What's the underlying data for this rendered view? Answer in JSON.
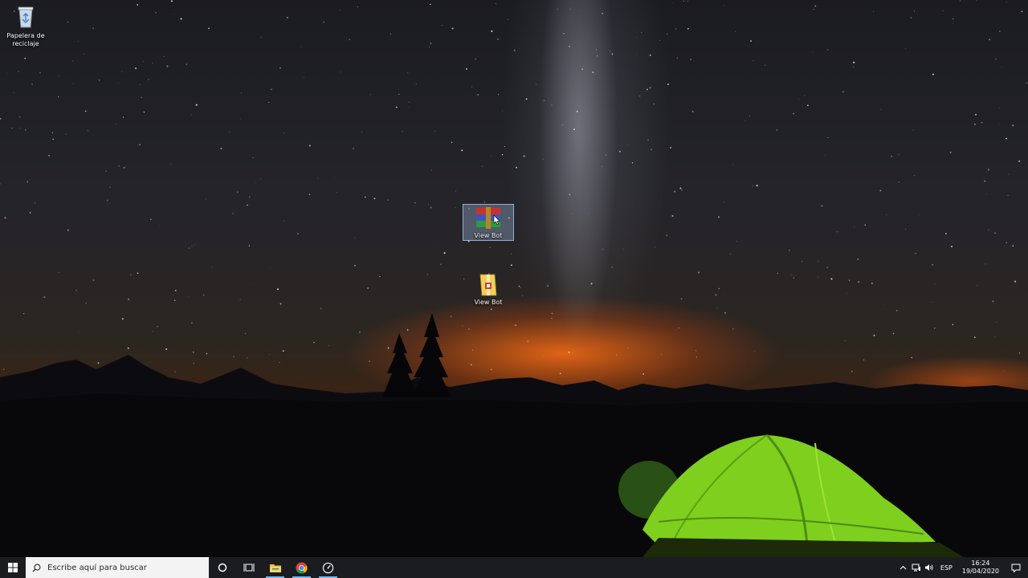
{
  "desktop": {
    "icons": [
      {
        "label": "Papelera de reciclaje",
        "icon": "recycle-bin-icon"
      },
      {
        "label": "View Bot",
        "icon": "winrar-archive-icon",
        "selected": true
      },
      {
        "label": "View Bot",
        "icon": "zip-folder-icon"
      }
    ]
  },
  "taskbar": {
    "start_icon": "windows-start-icon",
    "search": {
      "placeholder": "Escribe aquí para buscar",
      "icon": "search-icon"
    },
    "buttons": [
      {
        "name": "cortana",
        "icon": "cortana-circle-icon"
      },
      {
        "name": "task-view",
        "icon": "task-view-icon"
      },
      {
        "name": "file-explorer",
        "icon": "folder-icon",
        "active": true
      },
      {
        "name": "chrome",
        "icon": "chrome-icon",
        "active": true
      },
      {
        "name": "app",
        "icon": "speedometer-app-icon",
        "active": true
      }
    ],
    "tray": {
      "language": "ESP",
      "time": "16:24",
      "date": "19/04/2020"
    }
  },
  "colors": {
    "taskbar_bg": "#1a1c20",
    "accent": "#76b9ed",
    "selection": "#a0bee6"
  }
}
